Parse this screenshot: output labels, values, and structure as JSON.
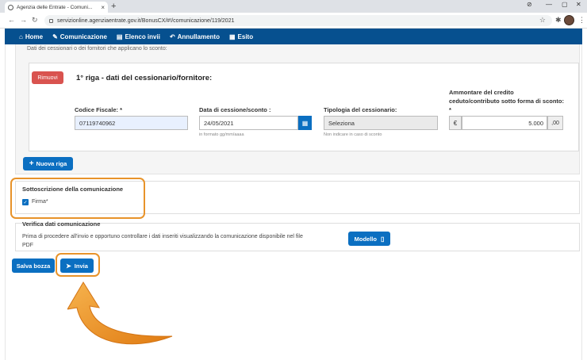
{
  "browser": {
    "tab_title": "Agenzia delle Entrate - Comuni...",
    "tab_close": "×",
    "new_tab": "+",
    "url": "servizionline.agenziaentrate.gov.it/BonusCX/#!/comunicazione/119/2021",
    "win_controls": [
      "⊘",
      "—",
      "▢",
      "✕"
    ]
  },
  "navbar": {
    "items": [
      {
        "label": "Home",
        "icon": "home-icon",
        "glyph": "⌂"
      },
      {
        "label": "Comunicazione",
        "icon": "pencil-icon",
        "glyph": "✎"
      },
      {
        "label": "Elenco invii",
        "icon": "book-icon",
        "glyph": "▤"
      },
      {
        "label": "Annullamento",
        "icon": "undo-icon",
        "glyph": "↶"
      },
      {
        "label": "Esito",
        "icon": "list-icon",
        "glyph": "▦"
      }
    ]
  },
  "section_note": "Dati dei cessionari o dei fornitori che applicano lo sconto:",
  "row_card": {
    "remove_label": "Rimuovi",
    "title": "1° riga - dati del cessionario/fornitore:",
    "codice_fiscale_label": "Codice Fiscale: *",
    "codice_fiscale_value": "07119740962",
    "data_label": "Data di cessione/sconto :",
    "data_value": "24/05/2021",
    "data_hint": "in formato gg/mm/aaaa",
    "tipologia_label": "Tipologia del cessionario:",
    "tipologia_value": "Seleziona",
    "tipologia_hint": "Non indicare in caso di sconto",
    "ammontare_label_1": "Ammontare del credito",
    "ammontare_label_2": "ceduto/contributo sotto forma di sconto:",
    "ammontare_label_3": "*",
    "currency": "€",
    "ammontare_value": "5.000",
    "decimals": ",00"
  },
  "nuova_riga_label": "Nuova riga",
  "sottoscrizione": {
    "title": "Sottoscrizione della comunicazione",
    "firma_label": "Firma*",
    "checked": true
  },
  "verifica": {
    "title": "Verifica dati comunicazione",
    "text_1": "Prima di procedere all'invio e opportuno controllare i dati inseriti visualizzando la comunicazione disponibile nel file",
    "text_2": "PDF",
    "modello_label": "Modello"
  },
  "actions": {
    "salva_label": "Salva bozza",
    "invia_label": "Invia"
  },
  "colors": {
    "navbar": "#06508f",
    "primary": "#0b6fc1",
    "danger": "#d9534f",
    "highlight": "#e8932a"
  }
}
